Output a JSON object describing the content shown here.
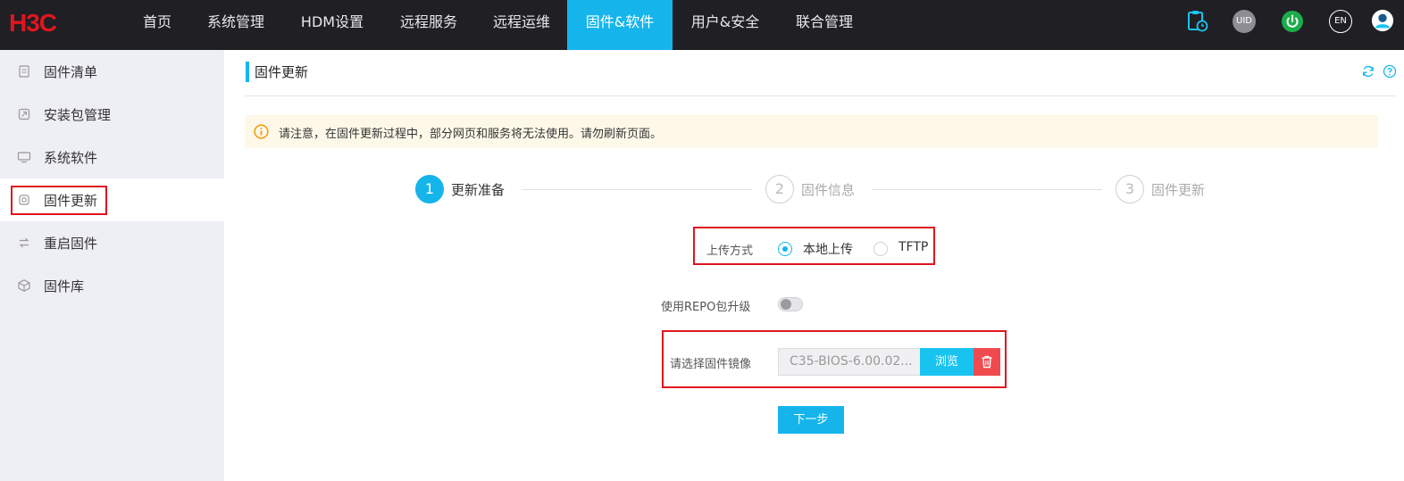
{
  "brand": {
    "logo_text": "H3C",
    "accent": "#15b5ec",
    "logo_color": "#e0151f"
  },
  "nav": {
    "items": [
      {
        "label": "首页"
      },
      {
        "label": "系统管理"
      },
      {
        "label": "HDM设置"
      },
      {
        "label": "远程服务"
      },
      {
        "label": "远程运维"
      },
      {
        "label": "固件&软件",
        "active": true
      },
      {
        "label": "用户&安全"
      },
      {
        "label": "联合管理"
      }
    ],
    "right_icons": {
      "clipboard": "clipboard-clock-icon",
      "uid": "UID",
      "power": "power-icon",
      "lang": "EN",
      "user": "user-avatar-icon"
    }
  },
  "sidebar": {
    "items": [
      {
        "label": "固件清单",
        "icon": "clipboard-list-icon"
      },
      {
        "label": "安装包管理",
        "icon": "package-icon"
      },
      {
        "label": "系统软件",
        "icon": "monitor-icon"
      },
      {
        "label": "固件更新",
        "icon": "chip-icon",
        "active": true
      },
      {
        "label": "重启固件",
        "icon": "swap-arrows-icon"
      },
      {
        "label": "固件库",
        "icon": "cube-icon"
      }
    ]
  },
  "main": {
    "title": "固件更新",
    "notice": "请注意，在固件更新过程中，部分网页和服务将无法使用。请勿刷新页面。",
    "steps": [
      {
        "num": "1",
        "label": "更新准备",
        "active": true
      },
      {
        "num": "2",
        "label": "固件信息",
        "active": false
      },
      {
        "num": "3",
        "label": "固件更新",
        "active": false
      }
    ],
    "upload": {
      "label": "上传方式",
      "options": [
        "本地上传",
        "TFTP"
      ],
      "selected": "本地上传"
    },
    "repo": {
      "label": "使用REPO包升级",
      "enabled": false
    },
    "image": {
      "label": "请选择固件镜像",
      "value": "C35-BIOS-6.00.02...",
      "browse_label": "浏览"
    },
    "next_label": "下一步"
  }
}
